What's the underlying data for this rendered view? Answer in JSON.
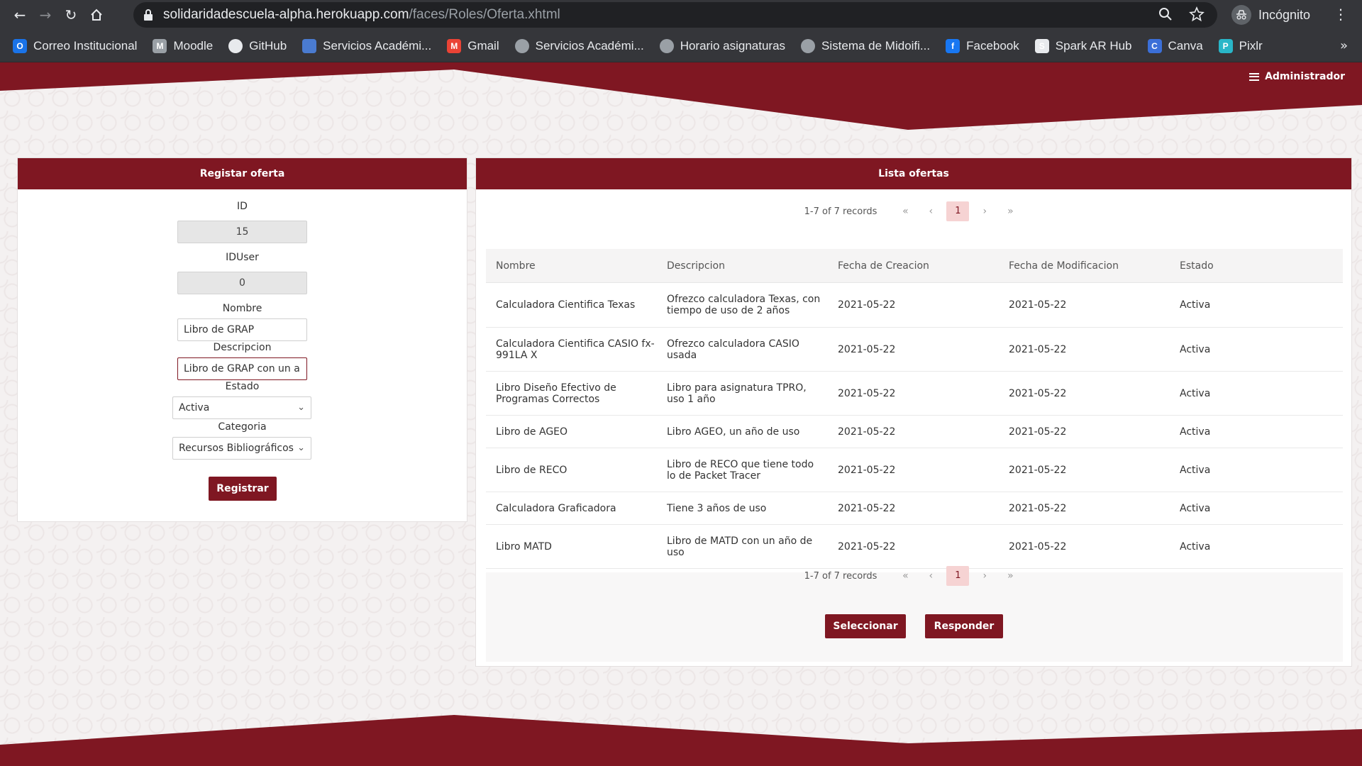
{
  "browser": {
    "url_host": "solidaridadescuela-alpha.herokuapp.com",
    "url_path": "/faces/Roles/Oferta.xhtml",
    "profile_label": "Incógnito",
    "bookmarks": [
      {
        "label": "Correo Institucional",
        "icon": "outlook-icon",
        "color": "#1a73e8",
        "glyph": "O"
      },
      {
        "label": "Moodle",
        "icon": "moodle-icon",
        "color": "#9aa0a6",
        "glyph": "M"
      },
      {
        "label": "GitHub",
        "icon": "github-icon",
        "color": "#e8eaed",
        "glyph": ""
      },
      {
        "label": "Servicios Académi...",
        "icon": "page-icon",
        "color": "#4a7bd0",
        "glyph": ""
      },
      {
        "label": "Gmail",
        "icon": "gmail-icon",
        "color": "#ea4335",
        "glyph": "M"
      },
      {
        "label": "Servicios Académi...",
        "icon": "globe-icon",
        "color": "#9aa0a6",
        "glyph": ""
      },
      {
        "label": "Horario asignaturas",
        "icon": "globe-icon",
        "color": "#9aa0a6",
        "glyph": ""
      },
      {
        "label": "Sistema de Midoifi...",
        "icon": "globe-icon",
        "color": "#9aa0a6",
        "glyph": ""
      },
      {
        "label": "Facebook",
        "icon": "facebook-icon",
        "color": "#1877f2",
        "glyph": "f"
      },
      {
        "label": "Spark AR Hub",
        "icon": "spark-ar-icon",
        "color": "#e8eaed",
        "glyph": "S"
      },
      {
        "label": "Canva",
        "icon": "canva-icon",
        "color": "#3b6fd8",
        "glyph": "C"
      },
      {
        "label": "Pixlr",
        "icon": "pixlr-icon",
        "color": "#29b6c8",
        "glyph": "P"
      }
    ]
  },
  "header": {
    "admin_label": "Administrador"
  },
  "form": {
    "title": "Registar oferta",
    "id_label": "ID",
    "id_value": "15",
    "iduser_label": "IDUser",
    "iduser_value": "0",
    "nombre_label": "Nombre",
    "nombre_value": "Libro de GRAP",
    "descripcion_label": "Descripcion",
    "descripcion_value": "Libro de GRAP con un a",
    "estado_label": "Estado",
    "estado_value": "Activa",
    "categoria_label": "Categoria",
    "categoria_value": "Recursos Bibliográficos",
    "submit_label": "Registrar"
  },
  "list": {
    "title": "Lista ofertas",
    "records_label": "1-7 of 7 records",
    "current_page": "1",
    "columns": [
      "Nombre",
      "Descripcion",
      "Fecha de Creacion",
      "Fecha de Modificacion",
      "Estado"
    ],
    "rows": [
      {
        "nombre": "Calculadora Cientifica Texas",
        "descripcion": "Ofrezco calculadora Texas, con tiempo de uso de 2 años",
        "creacion": "2021-05-22",
        "modificacion": "2021-05-22",
        "estado": "Activa"
      },
      {
        "nombre": "Calculadora Cientifica CASIO fx-991LA X",
        "descripcion": "Ofrezco calculadora CASIO usada",
        "creacion": "2021-05-22",
        "modificacion": "2021-05-22",
        "estado": "Activa"
      },
      {
        "nombre": "Libro Diseño Efectivo de Programas Correctos",
        "descripcion": "Libro para asignatura TPRO, uso 1 año",
        "creacion": "2021-05-22",
        "modificacion": "2021-05-22",
        "estado": "Activa"
      },
      {
        "nombre": "Libro de AGEO",
        "descripcion": "Libro AGEO, un año de uso",
        "creacion": "2021-05-22",
        "modificacion": "2021-05-22",
        "estado": "Activa"
      },
      {
        "nombre": "Libro de RECO",
        "descripcion": "Libro de RECO que tiene todo lo de Packet Tracer",
        "creacion": "2021-05-22",
        "modificacion": "2021-05-22",
        "estado": "Activa"
      },
      {
        "nombre": "Calculadora Graficadora",
        "descripcion": "Tiene 3 años de uso",
        "creacion": "2021-05-22",
        "modificacion": "2021-05-22",
        "estado": "Activa"
      },
      {
        "nombre": "Libro MATD",
        "descripcion": "Libro de MATD con un año de uso",
        "creacion": "2021-05-22",
        "modificacion": "2021-05-22",
        "estado": "Activa"
      }
    ],
    "select_label": "Seleccionar",
    "reply_label": "Responder"
  },
  "colors": {
    "brand": "#7f1722",
    "page_current": "#f6d3d3"
  }
}
